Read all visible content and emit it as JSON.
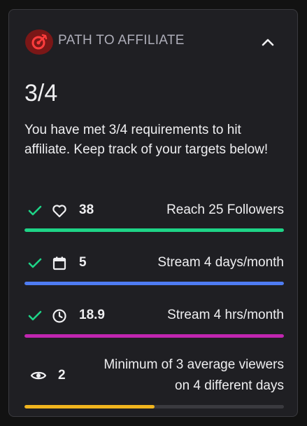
{
  "header": {
    "title": "PATH TO AFFILIATE",
    "badge_icon": "goal-target-icon",
    "collapse_icon": "chevron-up-icon"
  },
  "progress": {
    "count": "3/4",
    "description": "You have met 3/4 requirements to hit affiliate. Keep track of your targets below!"
  },
  "requirements": [
    {
      "met": true,
      "icon": "heart-icon",
      "value": "38",
      "label": "Reach 25 Followers",
      "progress": 1.0,
      "color": "#1ed487"
    },
    {
      "met": true,
      "icon": "calendar-icon",
      "value": "5",
      "label": "Stream 4 days/month",
      "progress": 1.0,
      "color": "#4e7cf2"
    },
    {
      "met": true,
      "icon": "clock-icon",
      "value": "18.9",
      "label": "Stream 4 hrs/month",
      "progress": 1.0,
      "color": "#c026b0"
    },
    {
      "met": false,
      "icon": "eye-icon",
      "value": "2",
      "label_line1": "Minimum of 3 average viewers",
      "label_line2": "on 4 different days",
      "progress": 0.5,
      "color": "#f0b41e"
    }
  ],
  "colors": {
    "check": "#1ed487",
    "badge_bg": "#7a1717",
    "badge_icon": "#ff3d3d"
  }
}
